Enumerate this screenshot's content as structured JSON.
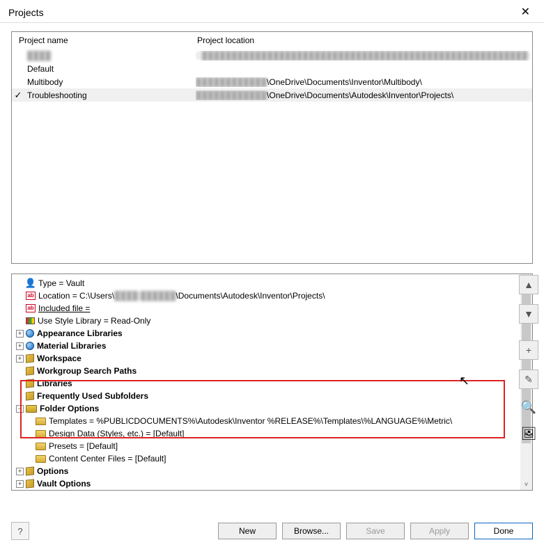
{
  "window": {
    "title": "Projects"
  },
  "list": {
    "headers": {
      "name": "Project name",
      "location": "Project location"
    },
    "rows": [
      {
        "checked": false,
        "name": "████",
        "name_blur": true,
        "location": "C███████████████████████████████████████████████████████\\",
        "loc_blur": true
      },
      {
        "checked": false,
        "name": "Default",
        "location": ""
      },
      {
        "checked": false,
        "name": "Multibody",
        "location_prefix": "████████████",
        "location": "\\OneDrive\\Documents\\Inventor\\Multibody\\"
      },
      {
        "checked": true,
        "name": "Troubleshooting",
        "selected": true,
        "location_prefix": "████████████",
        "location": "\\OneDrive\\Documents\\Autodesk\\Inventor\\Projects\\"
      }
    ]
  },
  "tree": {
    "type": "Type = Vault",
    "location_label": "Location = C:\\Users\\",
    "location_blur": "████\\██████",
    "location_suffix": "\\Documents\\Autodesk\\Inventor\\Projects\\",
    "included_file": "Included file = ",
    "use_style": "Use Style Library = Read-Only",
    "appearance": "Appearance Libraries",
    "material": "Material Libraries",
    "workspace": "Workspace",
    "workgroup": "Workgroup Search Paths",
    "libraries": "Libraries",
    "frequent": "Frequently Used Subfolders",
    "folder_options": "Folder Options",
    "templates": "Templates = %PUBLICDOCUMENTS%\\Autodesk\\Inventor %RELEASE%\\Templates\\%LANGUAGE%\\Metric\\",
    "design_data": "Design Data (Styles, etc.) = [Default]",
    "presets": "Presets = [Default]",
    "contentcenter": "Content Center Files = [Default]",
    "options": "Options",
    "vault_options": "Vault Options"
  },
  "buttons": {
    "new": "New",
    "browse": "Browse...",
    "save": "Save",
    "apply": "Apply",
    "done": "Done",
    "help": "?"
  },
  "side": {
    "up": "▲",
    "down": "▼",
    "plus": "+",
    "pencil": "✎",
    "mag": "🔍",
    "img": "🖼"
  }
}
